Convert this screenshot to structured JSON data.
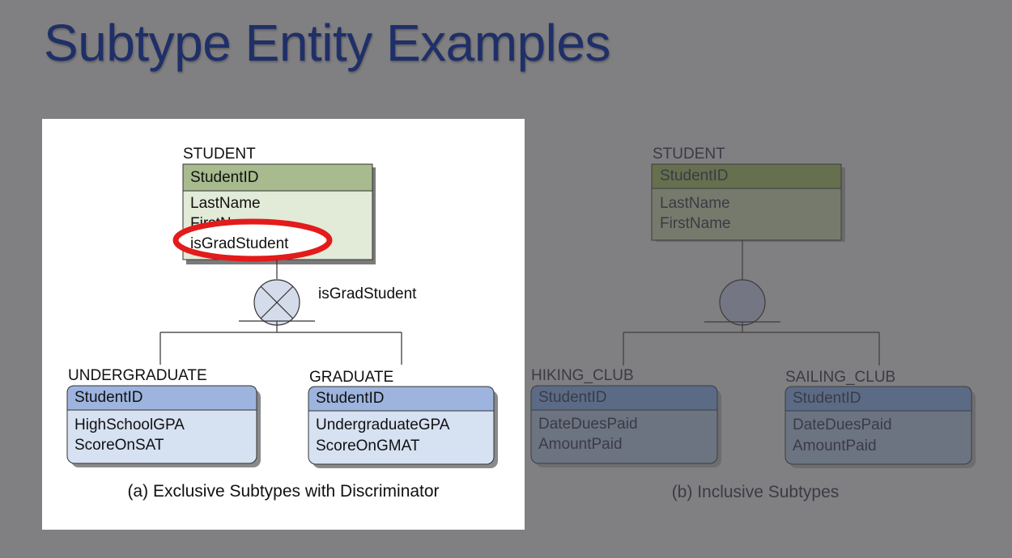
{
  "slide": {
    "title": "Subtype Entity Examples"
  },
  "panel_a": {
    "caption": "(a) Exclusive Subtypes with Discriminator",
    "supertype": {
      "name": "STUDENT",
      "key": "StudentID",
      "attributes": [
        "LastName",
        "FirstName",
        "isGradStudent"
      ]
    },
    "discriminator": "isGradStudent",
    "subtypes": [
      {
        "name": "UNDERGRADUATE",
        "key": "StudentID",
        "attributes": [
          "HighSchoolGPA",
          "ScoreOnSAT"
        ]
      },
      {
        "name": "GRADUATE",
        "key": "StudentID",
        "attributes": [
          "UndergraduateGPA",
          "ScoreOnGMAT"
        ]
      }
    ]
  },
  "panel_b": {
    "caption": "(b) Inclusive Subtypes",
    "supertype": {
      "name": "STUDENT",
      "key": "StudentID",
      "attributes": [
        "LastName",
        "FirstName"
      ]
    },
    "subtypes": [
      {
        "name": "HIKING_CLUB",
        "key": "StudentID",
        "attributes": [
          "DateDuesPaid",
          "AmountPaid"
        ]
      },
      {
        "name": "SAILING_CLUB",
        "key": "StudentID",
        "attributes": [
          "DateDuesPaid",
          "AmountPaid"
        ]
      }
    ]
  },
  "colors": {
    "slide_background": "#807f81",
    "title": "#1f2f68",
    "highlight_ellipse": "#e31b1b",
    "supertype_header_a": "#a7bb8e",
    "supertype_body_a": "#e2ead8",
    "subtype_header_a": "#9db4de",
    "subtype_body_a": "#d6e1f2",
    "supertype_header_b": "#66704f",
    "supertype_body_b": "#767a6c",
    "subtype_header_b": "#5b6b86",
    "subtype_body_b": "#6c7482",
    "dim_text": "#3b3b45"
  }
}
